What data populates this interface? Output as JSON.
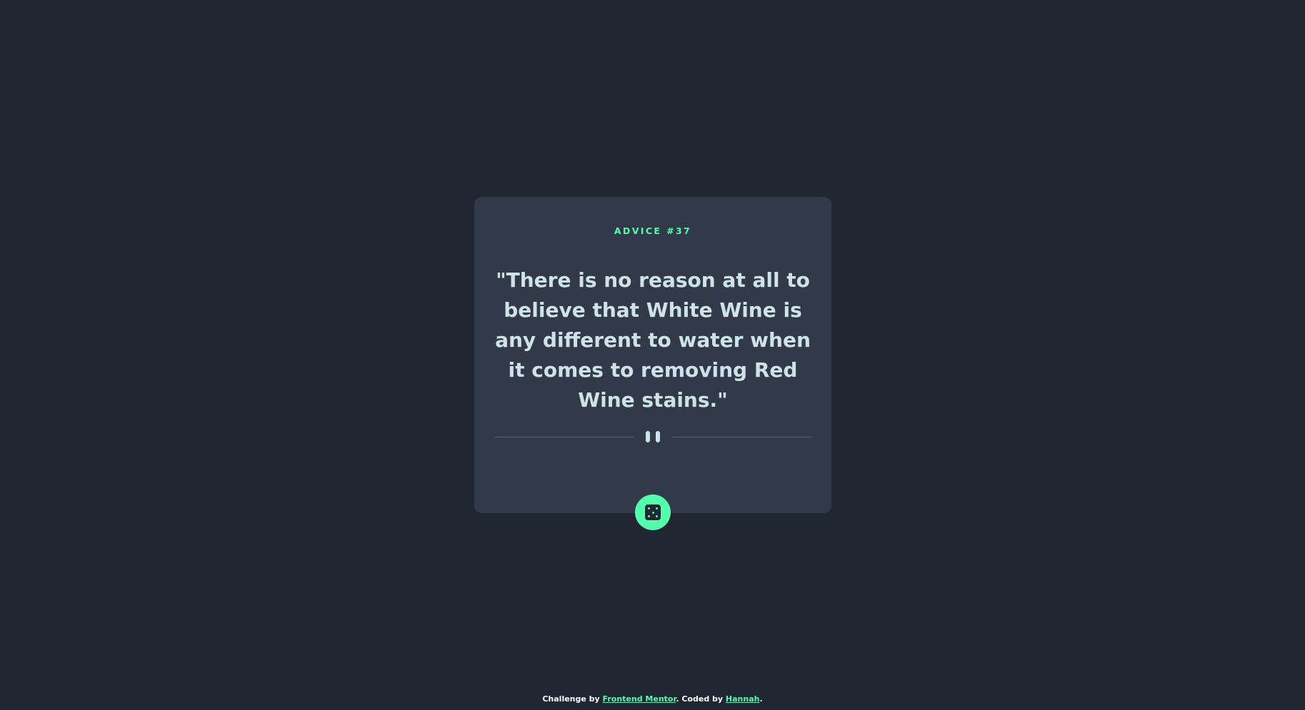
{
  "advice": {
    "heading": "ADVICE #37",
    "quote": "\"There is no reason at all to believe that White Wine is any different to water when it comes to removing Red Wine stains.\""
  },
  "divider": {
    "icon": "pause-icon"
  },
  "dice_button": {
    "icon": "dice-icon"
  },
  "footer": {
    "prefix": "Challenge by ",
    "link1": "Frontend Mentor",
    "middle": ". Coded by ",
    "link2": "Hannah",
    "suffix": "."
  },
  "colors": {
    "background": "#202733",
    "card": "#323a49",
    "accent": "#53ffaa",
    "text": "#cee3e9",
    "divider": "#4f5d74"
  }
}
